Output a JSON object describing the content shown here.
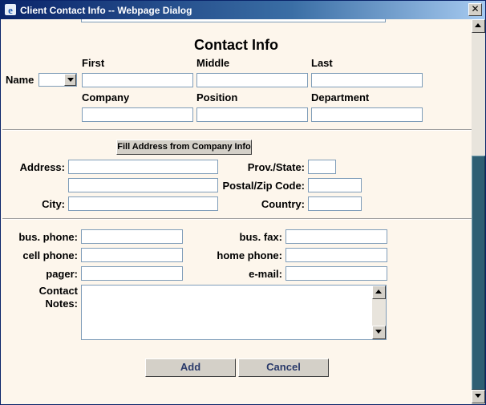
{
  "window": {
    "title": "Client Contact Info -- Webpage Dialog",
    "close_label": "✕"
  },
  "form": {
    "heading": "Contact Info",
    "name_label": "Name",
    "name_prefix_value": "",
    "first_label": "First",
    "middle_label": "Middle",
    "last_label": "Last",
    "company_label": "Company",
    "position_label": "Position",
    "department_label": "Department",
    "fill_address_button": "Fill Address from Company Info",
    "address_label": "Address:",
    "prov_state_label": "Prov./State:",
    "postal_zip_label": "Postal/Zip Code:",
    "city_label": "City:",
    "country_label": "Country:",
    "bus_phone_label": "bus. phone:",
    "bus_fax_label": "bus. fax:",
    "cell_phone_label": "cell phone:",
    "home_phone_label": "home phone:",
    "pager_label": "pager:",
    "email_label": "e-mail:",
    "contact_notes_label_1": "Contact",
    "contact_notes_label_2": "Notes:",
    "values": {
      "first": "",
      "middle": "",
      "last": "",
      "company": "",
      "position": "",
      "department": "",
      "address1": "",
      "address2": "",
      "city": "",
      "prov_state": "",
      "postal_zip": "",
      "country": "",
      "bus_phone": "",
      "bus_fax": "",
      "cell_phone": "",
      "home_phone": "",
      "pager": "",
      "email": "",
      "notes": ""
    }
  },
  "actions": {
    "add_label": "Add",
    "cancel_label": "Cancel"
  },
  "colors": {
    "background": "#fdf6ec",
    "titlebar": "#0a246a",
    "scroll_thumb": "#2f5f73",
    "button_text": "#2a3a6a"
  }
}
